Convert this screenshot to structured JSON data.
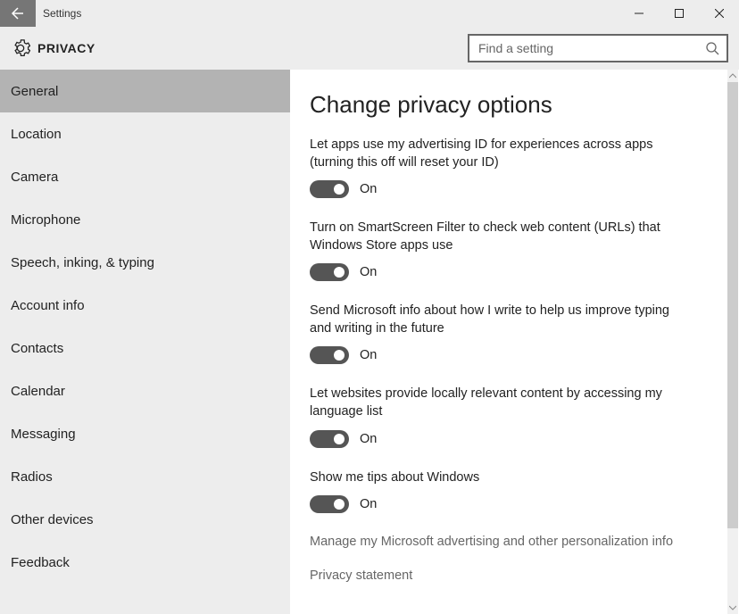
{
  "app_title": "Settings",
  "page": "PRIVACY",
  "search": {
    "placeholder": "Find a setting"
  },
  "sidebar": {
    "items": [
      {
        "label": "General",
        "selected": true
      },
      {
        "label": "Location",
        "selected": false
      },
      {
        "label": "Camera",
        "selected": false
      },
      {
        "label": "Microphone",
        "selected": false
      },
      {
        "label": "Speech, inking, & typing",
        "selected": false
      },
      {
        "label": "Account info",
        "selected": false
      },
      {
        "label": "Contacts",
        "selected": false
      },
      {
        "label": "Calendar",
        "selected": false
      },
      {
        "label": "Messaging",
        "selected": false
      },
      {
        "label": "Radios",
        "selected": false
      },
      {
        "label": "Other devices",
        "selected": false
      },
      {
        "label": "Feedback",
        "selected": false
      }
    ]
  },
  "content": {
    "heading": "Change privacy options",
    "settings": [
      {
        "desc": "Let apps use my advertising ID for experiences across apps (turning this off will reset your ID)",
        "state": "On"
      },
      {
        "desc": "Turn on SmartScreen Filter to check web content (URLs) that Windows Store apps use",
        "state": "On"
      },
      {
        "desc": "Send Microsoft info about how I write to help us improve typing and writing in the future",
        "state": "On"
      },
      {
        "desc": "Let websites provide locally relevant content by accessing my language list",
        "state": "On"
      },
      {
        "desc": "Show me tips about Windows",
        "state": "On"
      }
    ],
    "links": [
      "Manage my Microsoft advertising and other personalization info",
      "Privacy statement"
    ]
  }
}
